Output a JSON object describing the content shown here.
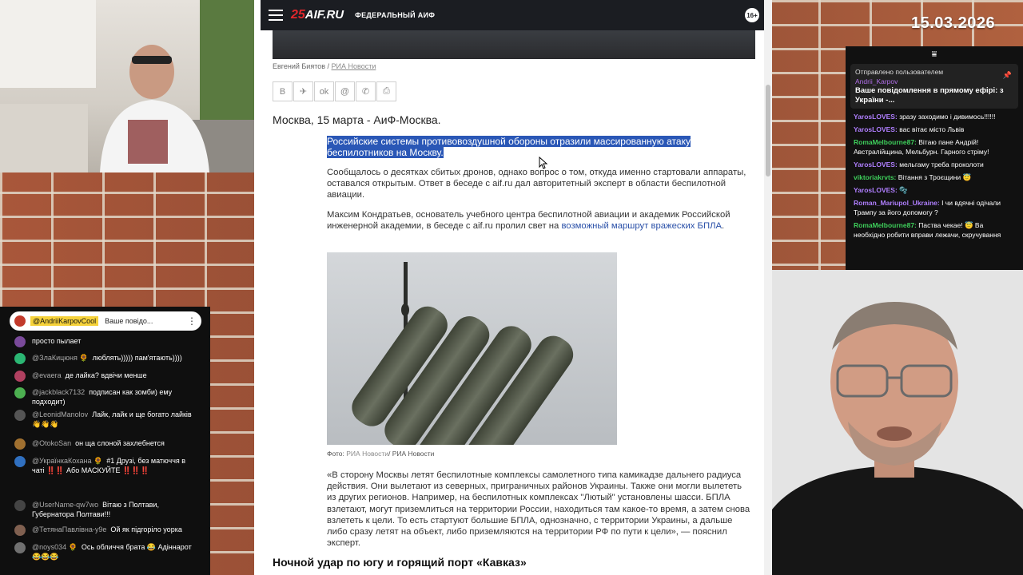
{
  "date_stamp": "15.03.2026",
  "site": {
    "logo_text": "AIF.RU",
    "logo_num": "25",
    "region": "ФЕДЕРАЛЬНЫЙ АИФ",
    "age_badge": "16+"
  },
  "article": {
    "photo_credit_author": "Евгений Биятов",
    "photo_credit_source": "РИА Новости",
    "share_buttons": [
      "В",
      "✈",
      "ok",
      "@",
      "✆",
      "⎙"
    ],
    "dateline": "Москва, 15 марта - АиФ-Москва.",
    "lead": "Российские системы противовоздушной обороны отразили массированную атаку беспилотников на Москву.",
    "p1": "Сообщалось о десятках сбитых дронов, однако вопрос о том, откуда именно стартовали аппараты, оставался открытым. Ответ в беседе с aif.ru дал авторитетный эксперт в области беспилотной авиации.",
    "p2_text": "Максим Кондратьев, основатель учебного центра беспилотной авиации и академик Российской инженерной академии, в беседе с aif.ru пролил свет на ",
    "p2_link": "возможный маршрут вражеских БПЛА",
    "p2_end": ".",
    "photo_caption_prefix": "Фото: ",
    "photo_caption_link": "РИА Новости",
    "photo_caption_suffix": "/ РИА Новости",
    "quote": "«В сторону Москвы летят беспилотные комплексы самолетного типа камикадзе дальнего радиуса действия. Они вылетают из северных, приграничных районов Украины. Также они могли вылететь из других регионов. Например, на беспилотных комплексах \"Лютый\" установлены шасси. БПЛА взлетают, могут приземлиться на территории России, находиться там какое-то время, а затем снова взлететь к цели. То есть стартуют большие БПЛА, однозначно, с территории Украины, а дальше либо сразу летят на объект, либо приземляются на территории РФ по пути к цели», — пояснил эксперт.",
    "subhead": "Ночной удар по югу и горящий порт «Кавказ»"
  },
  "left_chat": {
    "pinned_name": "@AndriiKarpovCool",
    "pinned_text": "Ваше повідо...",
    "messages": [
      {
        "name": "",
        "text": "просто пылает",
        "color": "#7a4a9a"
      },
      {
        "name": "@ЗлаКицюня 🌻",
        "text": "люблять))))) пам'ятають))))",
        "color": "#2bb673"
      },
      {
        "name": "@evaera",
        "text": "де лайка? вдвічи менше",
        "color": "#b04060"
      },
      {
        "name": "@jackblack7132",
        "text": "подписан как зомби) ему подходит)",
        "color": "#4caf50"
      },
      {
        "name": "@LeonidManolov",
        "text": "Лайк, лайк и ще богато лайків👋👋👋",
        "color": "#555555"
      },
      {
        "name": "@OtokoSan",
        "text": "он ща слоной захлебнется",
        "color": "#a07030"
      },
      {
        "name": "@УкраїнкаКохана 🌻",
        "text": "#1 Друзі, без матюччя в чаті ‼️‼️ Або МАСКУЙТЕ ‼️‼️‼️",
        "color": "#3070c0"
      },
      {
        "name": "@UserName-qw7wo",
        "text": "Вітаю з Полтави, Губернатора Полтави!!!",
        "color": "#444444"
      },
      {
        "name": "@ТетянаПавлівна-у9е",
        "text": "Ой як підгоріло уорка",
        "color": "#806050"
      },
      {
        "name": "@noys034 🌻",
        "text": "Ось обличчя брата 😂 Адіннарот 😂😂😂",
        "color": "#707070"
      }
    ]
  },
  "right_chat": {
    "pinned_by": "Отправлено пользователем",
    "pinned_user": "Andrii_Karpov",
    "pinned_text": "Ваше повідомлення в прямому ефірі: з України -...",
    "messages": [
      {
        "user": "YarosLOVES:",
        "text": "зразу заходимо і дивимось!!!!!!",
        "green": false
      },
      {
        "user": "YarosLOVES:",
        "text": "вас вітає місто Львів",
        "green": false
      },
      {
        "user": "RomaMelbourne87:",
        "text": "Вітаю пане Андрій! Австралійщина, Мельбурн. Гарного стріму!",
        "green": true
      },
      {
        "user": "YarosLOVES:",
        "text": "мельгаму треба проколоти",
        "green": false
      },
      {
        "user": "viktoriakrvts:",
        "text": "Вітання з Троєщини 😇",
        "green": true
      },
      {
        "user": "YarosLOVES:",
        "text": "🫧",
        "green": false
      },
      {
        "user": "Roman_Mariupol_Ukraine:",
        "text": "І чи вдячні одічали Трампу за його допомогу ?",
        "green": false
      },
      {
        "user": "RomaMelbourne87:",
        "text": "Паства чекае! 😇 Ва необхідно робити вправи лежачи, скручування",
        "green": true
      }
    ]
  }
}
